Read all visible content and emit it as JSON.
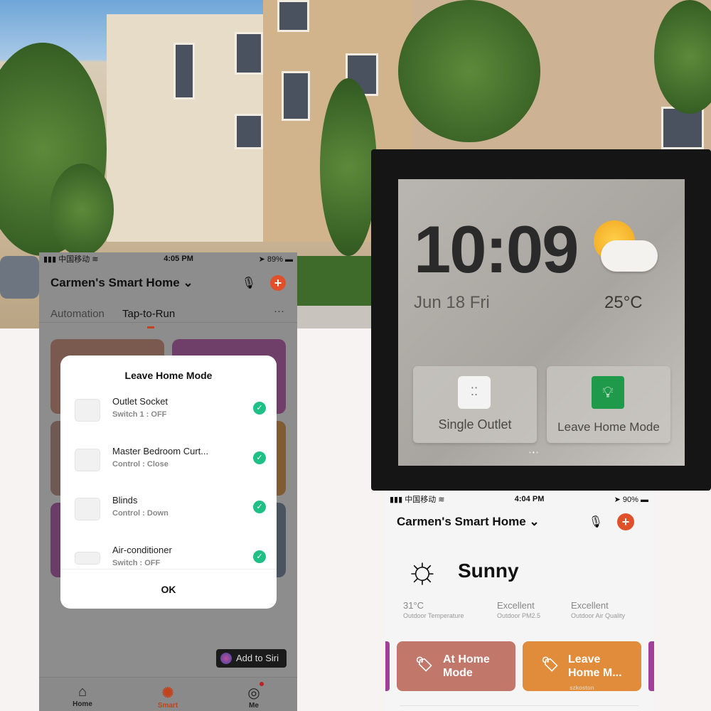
{
  "left_phone": {
    "status": {
      "carrier": "中国移动",
      "time": "4:05 PM",
      "battery": "89%"
    },
    "home_title": "Carmen's Smart Home",
    "tabs": [
      {
        "label": "Automation"
      },
      {
        "label": "Tap-to-Run",
        "active": true
      }
    ],
    "more": "···",
    "modal": {
      "title": "Leave Home Mode",
      "items": [
        {
          "name": "Outlet Socket",
          "status": "Switch 1 : OFF",
          "checked": true
        },
        {
          "name": "Master Bedroom Curt...",
          "status": "Control : Close",
          "checked": true
        },
        {
          "name": "Blinds",
          "status": "Control : Down",
          "checked": true
        },
        {
          "name": "Air-conditioner",
          "status": "Switch : OFF",
          "checked": true
        }
      ],
      "ok": "OK"
    },
    "siri": "Add to Siri",
    "nav": [
      {
        "label": "Home"
      },
      {
        "label": "Smart",
        "active": true
      },
      {
        "label": "Me",
        "badge": true
      }
    ]
  },
  "panel": {
    "time": "10:09",
    "date": "Jun 18 Fri",
    "temperature": "25°C",
    "weather_icon": "partly-cloudy-icon",
    "buttons": [
      {
        "label": "Single Outlet",
        "icon": "outlet-icon"
      },
      {
        "label": "Leave Home Mode",
        "icon": "lightbulb-icon"
      }
    ]
  },
  "right_phone": {
    "status": {
      "carrier": "中国移动",
      "time": "4:04 PM",
      "battery": "90%"
    },
    "home_title": "Carmen's Smart Home",
    "weather": "Sunny",
    "stats": [
      {
        "value": "31°C",
        "label": "Outdoor Temperature"
      },
      {
        "value": "Excellent",
        "label": "Outdoor PM2.5"
      },
      {
        "value": "Excellent",
        "label": "Outdoor Air Quality"
      }
    ],
    "scenes": [
      {
        "label1": "At Home",
        "label2": "Mode"
      },
      {
        "label1": "Leave",
        "label2": "Home M..."
      }
    ],
    "watermark": "szkoston"
  },
  "colors": {
    "accent": "#e0502a",
    "check": "#1fbf86",
    "scene1": "#c1776a",
    "scene2": "#e08c3a",
    "purple": "#a0409a"
  }
}
